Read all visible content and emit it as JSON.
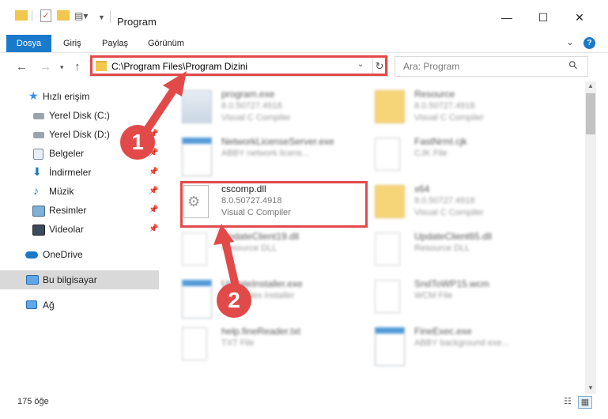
{
  "window": {
    "title": "Program",
    "controls": {
      "minimize": "—",
      "maximize": "☐",
      "close": "✕"
    }
  },
  "ribbon": {
    "tabs": [
      "Dosya",
      "Giriş",
      "Paylaş",
      "Görünüm"
    ],
    "help": "?"
  },
  "address": {
    "path": "C:\\Program Files\\Program Dizini",
    "search_placeholder": "Ara: Program"
  },
  "sidebar": {
    "items": [
      {
        "label": "Hızlı erişim",
        "icon": "star-icon",
        "pinned": false
      },
      {
        "label": "Yerel Disk (C:)",
        "icon": "drive-icon",
        "pinned": false
      },
      {
        "label": "Yerel Disk (D:)",
        "icon": "drive-icon",
        "pinned": true
      },
      {
        "label": "Belgeler",
        "icon": "documents-icon",
        "pinned": true
      },
      {
        "label": "İndirmeler",
        "icon": "download-icon",
        "pinned": true
      },
      {
        "label": "Müzik",
        "icon": "music-icon",
        "pinned": true
      },
      {
        "label": "Resimler",
        "icon": "pictures-icon",
        "pinned": true
      },
      {
        "label": "Videolar",
        "icon": "video-icon",
        "pinned": true
      },
      {
        "label": "OneDrive",
        "icon": "cloud-icon",
        "pinned": false
      },
      {
        "label": "Bu bilgisayar",
        "icon": "computer-icon",
        "pinned": false,
        "selected": true
      },
      {
        "label": "Ağ",
        "icon": "network-icon",
        "pinned": false
      }
    ]
  },
  "files": [
    {
      "name": "program.exe",
      "line2": "8.0.50727.4918",
      "line3": "Visual C Compiler"
    },
    {
      "name": "Resource",
      "line2": "8.0.50727.4918",
      "line3": "Visual C Compiler"
    },
    {
      "name": "NetworkLicenseServer.exe",
      "line2": "ABBY network licens...",
      "line3": ""
    },
    {
      "name": "FastNrml.cjk",
      "line2": "CJK File",
      "line3": ""
    },
    {
      "name": "cscomp.dll",
      "line2": "8.0.50727.4918",
      "line3": "Visual C Compiler"
    },
    {
      "name": "x64",
      "line2": "8.0.50727.4918",
      "line3": "Visual C Compiler"
    },
    {
      "name": "UpdateClient19.dll",
      "line2": "Resource DLL",
      "line3": ""
    },
    {
      "name": "UpdateClient65.dll",
      "line2": "Resource DLL",
      "line3": ""
    },
    {
      "name": "UpdateInstaller.exe",
      "line2": "... updates installer",
      "line3": ""
    },
    {
      "name": "SndToWP15.wcm",
      "line2": "WCM File",
      "line3": ""
    },
    {
      "name": "help.fineReader.txt",
      "line2": "TXT File",
      "line3": ""
    },
    {
      "name": "FineExec.exe",
      "line2": "ABBY background exe...",
      "line3": ""
    }
  ],
  "status": {
    "count": "175 öğe"
  },
  "annotations": {
    "badge1": "1",
    "badge2": "2"
  }
}
